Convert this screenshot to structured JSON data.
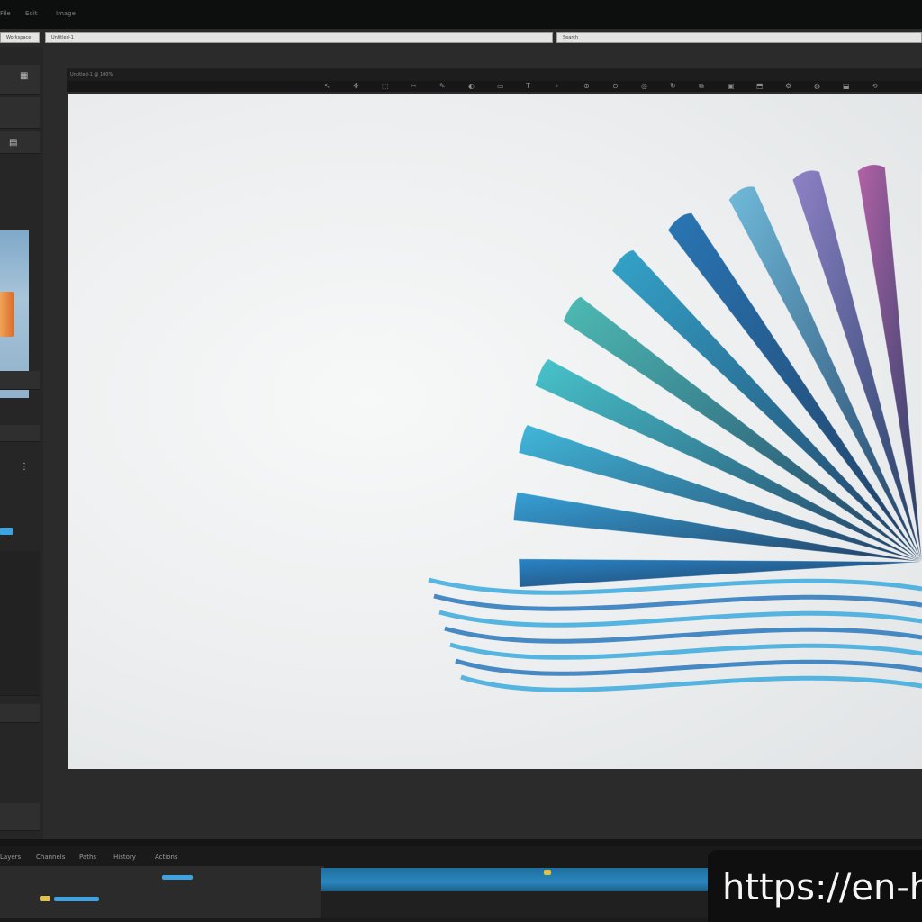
{
  "window": {
    "menu_items": [
      "File",
      "Edit",
      "Image"
    ]
  },
  "options_bar": {
    "fields": [
      "Workspace",
      "Untitled-1",
      "Search"
    ]
  },
  "document": {
    "tab_label": "Untitled-1 @ 100%"
  },
  "toolbar": {
    "glyphs": [
      "↖",
      "✥",
      "⬚",
      "✂",
      "✎",
      "◐",
      "▭",
      "T",
      "⌖",
      "⊕",
      "⊖",
      "◎",
      "↻",
      "⧉",
      "▣",
      "⬒",
      "⚙",
      "◍",
      "⬓",
      "⟲"
    ]
  },
  "left_panel": {
    "icons": [
      "▦",
      "▤",
      "⋮"
    ]
  },
  "dock": {
    "tabs": [
      "Layers",
      "Channels",
      "Paths",
      "History",
      "Actions"
    ]
  },
  "canvas_art": {
    "fan_colors": [
      "#1d7fc4",
      "#2c9bd3",
      "#38b4d8",
      "#3fc1c9",
      "#45b8b0",
      "#2a9fc7",
      "#1e6fb0",
      "#6ab7d8",
      "#8a7cc4",
      "#b05aa3",
      "#d94f7a"
    ]
  },
  "watermark": {
    "text": "https://en-h"
  },
  "colors": {
    "accent": "#3ea3e0",
    "panel": "#262626",
    "canvas": "#eceeef"
  }
}
